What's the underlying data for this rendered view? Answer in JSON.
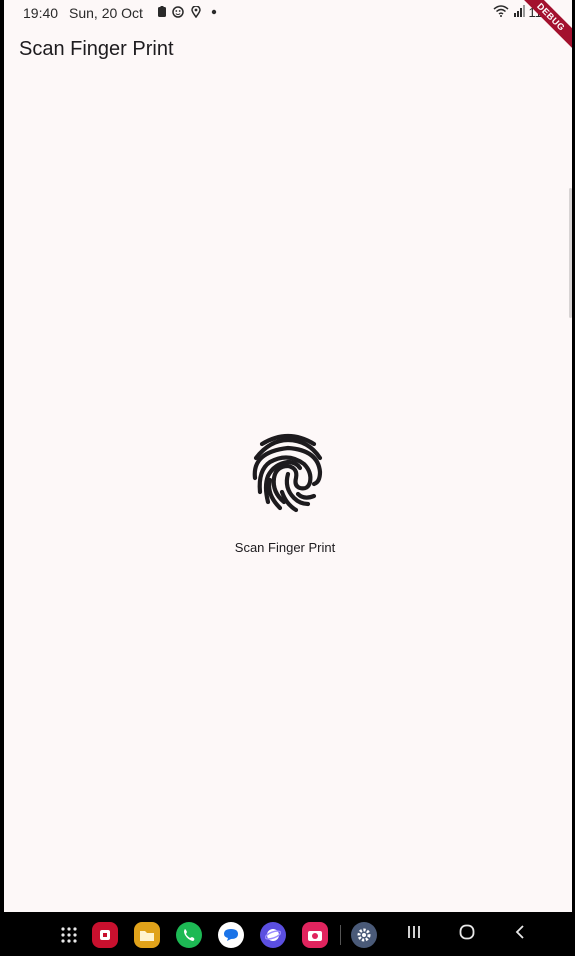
{
  "status_bar": {
    "time": "19:40",
    "date": "Sun, 20 Oct",
    "left_icons": [
      "battery-saver-icon",
      "face-icon",
      "location-icon",
      "dot-icon"
    ],
    "right_icons": [
      "wifi-icon",
      "signal-icon"
    ],
    "battery_text": "11"
  },
  "debug_banner": "DEBUG",
  "app_bar": {
    "title": "Scan Finger Print"
  },
  "main": {
    "icon": "fingerprint-icon",
    "label": "Scan Finger Print"
  },
  "nav_bar": {
    "dock_apps": [
      {
        "name": "app-grid-icon",
        "color": "#000000"
      },
      {
        "name": "app-red-icon",
        "color": "#c8102e"
      },
      {
        "name": "files-icon",
        "color": "#e0a21a"
      },
      {
        "name": "phone-icon",
        "color": "#1db954"
      },
      {
        "name": "messages-icon",
        "color": "#ffffff"
      },
      {
        "name": "internet-icon",
        "color": "#5b4fe0"
      },
      {
        "name": "camera-icon",
        "color": "#e0245e"
      },
      {
        "name": "settings-icon",
        "color": "#4a5a78"
      }
    ],
    "buttons": [
      "recents-icon",
      "home-icon",
      "back-icon"
    ]
  }
}
